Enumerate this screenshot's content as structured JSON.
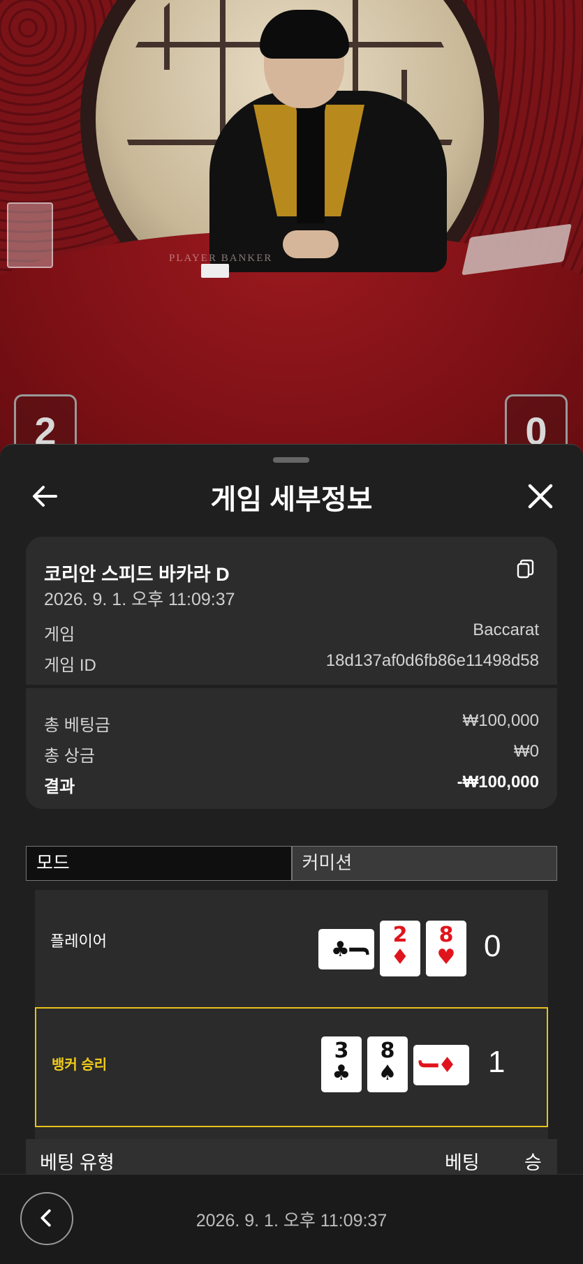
{
  "video": {
    "table_text": "PLAYER          BANKER",
    "score_left": "2",
    "score_right": "0"
  },
  "sheet": {
    "title": "게임 세부정보",
    "back_icon": "arrow-left-icon",
    "close_icon": "close-icon"
  },
  "info": {
    "game_name": "코리안 스피드 바카라 D",
    "datetime": "2026. 9. 1. 오후 11:09:37",
    "game_label": "게임",
    "game_value": "Baccarat",
    "game_id_label": "게임 ID",
    "game_id_value": "18d137af0d6fb86e11498d58",
    "total_bet_label": "총 베팅금",
    "total_bet_value": "₩100,000",
    "total_win_label": "총 상금",
    "total_win_value": "₩0",
    "result_label": "결과",
    "result_value": "-₩100,000"
  },
  "tabs": [
    {
      "label": "모드",
      "active": true
    },
    {
      "label": "커미션",
      "active": false
    }
  ],
  "results": {
    "player": {
      "label": "플레이어",
      "score": "0",
      "cards": [
        {
          "rank": "J",
          "suit": "♣",
          "color": "black",
          "orientation": "horizontal"
        },
        {
          "rank": "2",
          "suit": "♦",
          "color": "red",
          "orientation": "vertical"
        },
        {
          "rank": "8",
          "suit": "♥",
          "color": "red",
          "orientation": "vertical"
        }
      ]
    },
    "banker": {
      "label": "뱅커 승리",
      "score": "1",
      "cards": [
        {
          "rank": "3",
          "suit": "♣",
          "color": "black",
          "orientation": "vertical"
        },
        {
          "rank": "8",
          "suit": "♠",
          "color": "black",
          "orientation": "vertical"
        },
        {
          "rank": "J",
          "suit": "♦",
          "color": "red",
          "orientation": "horizontal"
        }
      ]
    }
  },
  "bet_table": {
    "col_type": "베팅 유형",
    "col_bet": "베팅",
    "col_win": "승"
  },
  "footer": {
    "datetime": "2026. 9. 1. 오후 11:09:37"
  },
  "colors": {
    "accent_yellow": "#f2cc1b",
    "card_red": "#e0141c",
    "sheet_bg": "#1f1f1f",
    "card_bg": "#2c2c2c"
  }
}
